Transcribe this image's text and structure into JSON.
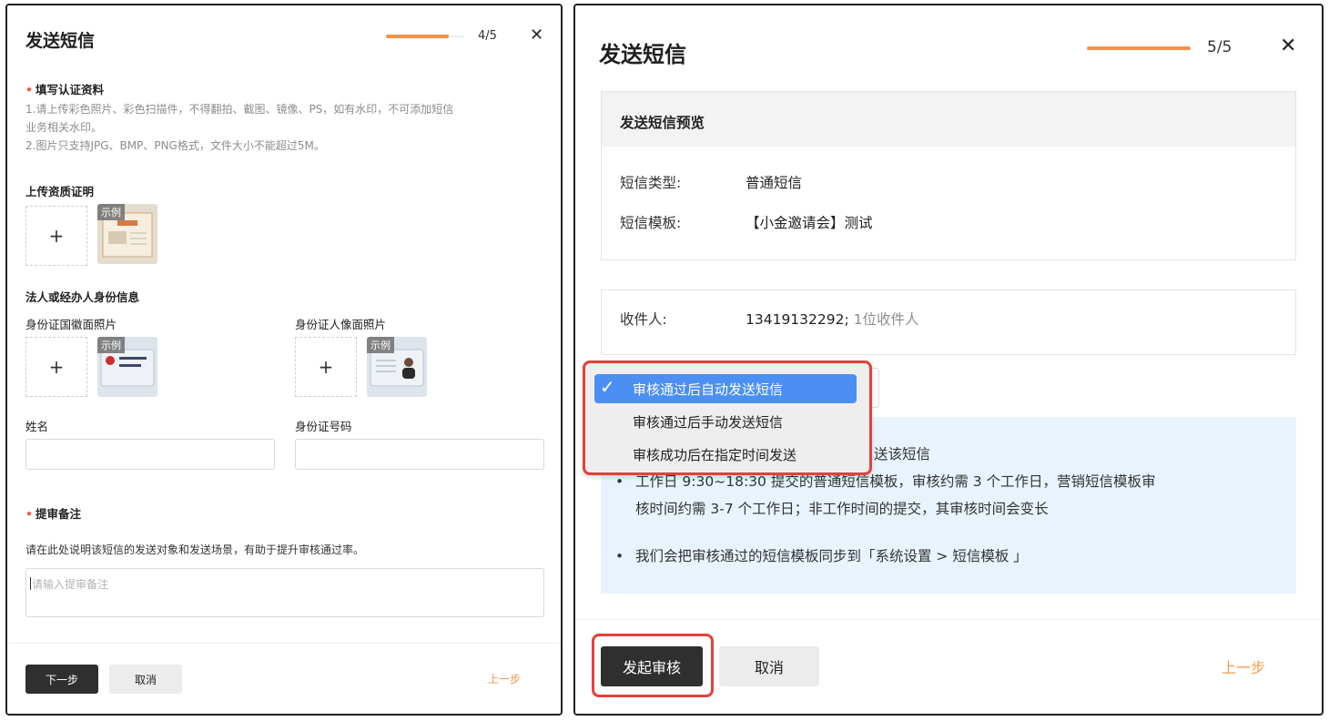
{
  "left": {
    "title": "发送短信",
    "step": "4/5",
    "progress": 0.8,
    "close": "✕",
    "cert_section": {
      "title": "填写认证资料",
      "hint1": "1.请上传彩色照片、彩色扫描件，不得翻拍、截图、镜像、PS，如有水印，不可添加短信",
      "hint1b": "业务相关水印。",
      "hint2": "2.图片只支持JPG、BMP、PNG格式，文件大小不能超过5M。"
    },
    "upload_cert_label": "上传资质证明",
    "plus": "+",
    "sample_tag": "示例",
    "identity_section_label": "法人或经办人身份信息",
    "id_emblem_label": "身份证国徽面照片",
    "id_portrait_label": "身份证人像面照片",
    "name_label": "姓名",
    "id_number_label": "身份证号码",
    "remark_section": {
      "title": "提审备注",
      "hint": "请在此处说明该短信的发送对象和发送场景，有助于提升审核通过率。",
      "placeholder": "请输入提审备注"
    },
    "buttons": {
      "next": "下一步",
      "cancel": "取消",
      "prev": "上一步"
    }
  },
  "right": {
    "title": "发送短信",
    "step": "5/5",
    "progress": 1.0,
    "close": "✕",
    "preview": {
      "heading": "发送短信预览",
      "type_label": "短信类型:",
      "type_value": "普通短信",
      "template_label": "短信模板:",
      "template_value": "【小金邀请会】测试"
    },
    "recipient": {
      "label": "收件人:",
      "number": "13419132292;",
      "count": "1位收件人"
    },
    "dropdown": {
      "options": [
        "审核通过后自动发送短信",
        "审核通过后手动发送短信",
        "审核成功后在指定时间发送"
      ],
      "selected_index": 0,
      "check": "✓"
    },
    "info": {
      "partial_line": "送该短信",
      "bullet1_line1": "工作日 9:30~18:30 提交的普通短信模板，审核约需 3 个工作日，营销短信模板审",
      "bullet1_line2": "核时间约需 3-7 个工作日；非工作时间的提交，其审核时间会变长",
      "bullet2": "我们会把审核通过的短信模板同步到「系统设置 > 短信模板 」",
      "dot": "•"
    },
    "buttons": {
      "submit": "发起审核",
      "cancel": "取消",
      "prev": "上一步"
    },
    "accent_color": "#f39a4c",
    "highlight_color": "#e5403a"
  }
}
